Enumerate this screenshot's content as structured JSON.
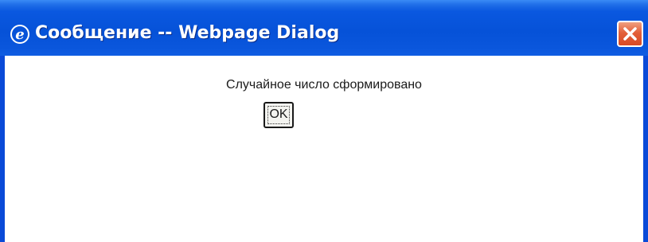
{
  "window": {
    "title": "Сообщение -- Webpage Dialog",
    "icon": "internet-explorer-icon",
    "close_icon": "close-icon",
    "titlebar_color": "#0a56dc",
    "close_color": "#e3603a"
  },
  "dialog": {
    "message": "Случайное число сформировано",
    "ok_label": "OK"
  }
}
